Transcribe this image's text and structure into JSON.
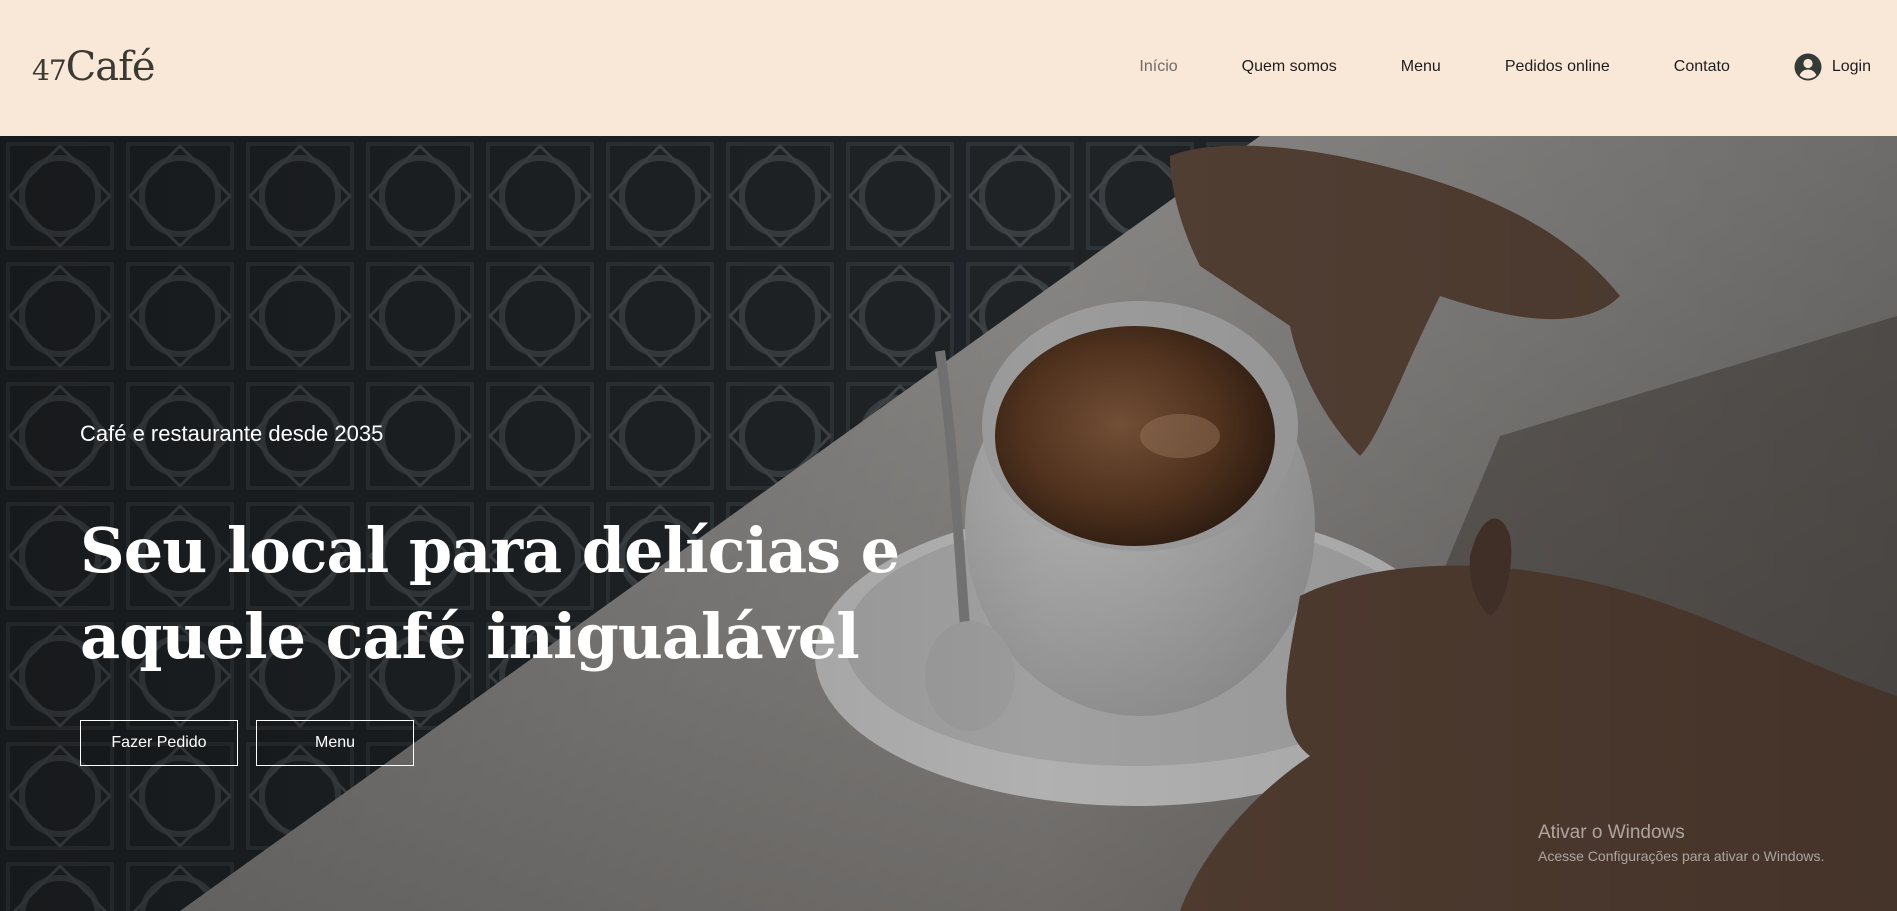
{
  "header": {
    "logo": {
      "number": "47",
      "word": "Café"
    },
    "nav": [
      {
        "label": "Início",
        "active": true
      },
      {
        "label": "Quem somos"
      },
      {
        "label": "Menu"
      },
      {
        "label": "Pedidos online"
      },
      {
        "label": "Contato"
      }
    ],
    "login": {
      "label": "Login",
      "icon": "user-circle-icon"
    }
  },
  "hero": {
    "subtitle": "Café e restaurante desde 2035",
    "headline": "Seu local para delícias e aquele café inigualável",
    "buttons": {
      "order": "Fazer Pedido",
      "menu": "Menu"
    }
  },
  "watermark": {
    "title": "Ativar o Windows",
    "subtitle": "Acesse Configurações para ativar o Windows."
  },
  "colors": {
    "header_bg": "#f9e7d8",
    "text_dark": "#1e1e1e",
    "nav_active": "#6f6a66",
    "hero_text": "#ffffff"
  }
}
